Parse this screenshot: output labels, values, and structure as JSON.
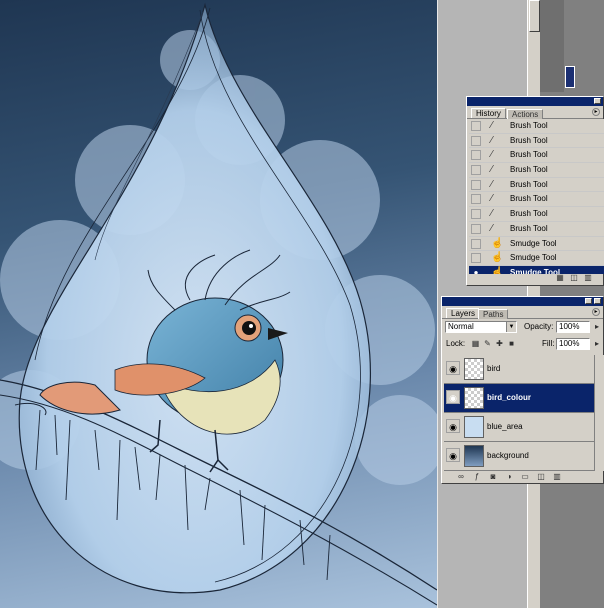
{
  "history_panel": {
    "tabs": [
      "History",
      "Actions"
    ],
    "items": [
      {
        "label": "Brush Tool",
        "tool": "brush"
      },
      {
        "label": "Brush Tool",
        "tool": "brush"
      },
      {
        "label": "Brush Tool",
        "tool": "brush"
      },
      {
        "label": "Brush Tool",
        "tool": "brush"
      },
      {
        "label": "Brush Tool",
        "tool": "brush"
      },
      {
        "label": "Brush Tool",
        "tool": "brush"
      },
      {
        "label": "Brush Tool",
        "tool": "brush"
      },
      {
        "label": "Brush Tool",
        "tool": "brush"
      },
      {
        "label": "Smudge Tool",
        "tool": "smudge"
      },
      {
        "label": "Smudge Tool",
        "tool": "smudge"
      },
      {
        "label": "Smudge Tool",
        "tool": "smudge",
        "selected": true
      }
    ]
  },
  "layers_panel": {
    "tabs": [
      "Layers",
      "Paths"
    ],
    "blend_mode": "Normal",
    "opacity_label": "Opacity:",
    "opacity_value": "100%",
    "lock_label": "Lock:",
    "fill_label": "Fill:",
    "fill_value": "100%",
    "layers": [
      {
        "name": "bird",
        "thumbnail": "transparent"
      },
      {
        "name": "bird_colour",
        "thumbnail": "transparent",
        "selected": true
      },
      {
        "name": "blue_area",
        "thumbnail": "light-blue"
      },
      {
        "name": "background",
        "thumbnail": "blue-gradient"
      }
    ]
  },
  "colors": {
    "selection": "#0a246a",
    "panel_bg": "#d4d0c8",
    "canvas_top": "#1f3652",
    "canvas_bottom": "#a9c2dc",
    "bird_blue": "#5f9bbf",
    "bird_orange": "#e0916a"
  },
  "icons": {
    "history_tool_brush": "brush-icon",
    "history_tool_smudge": "smudge-finger-icon",
    "layer_visibility": "eye-icon"
  }
}
